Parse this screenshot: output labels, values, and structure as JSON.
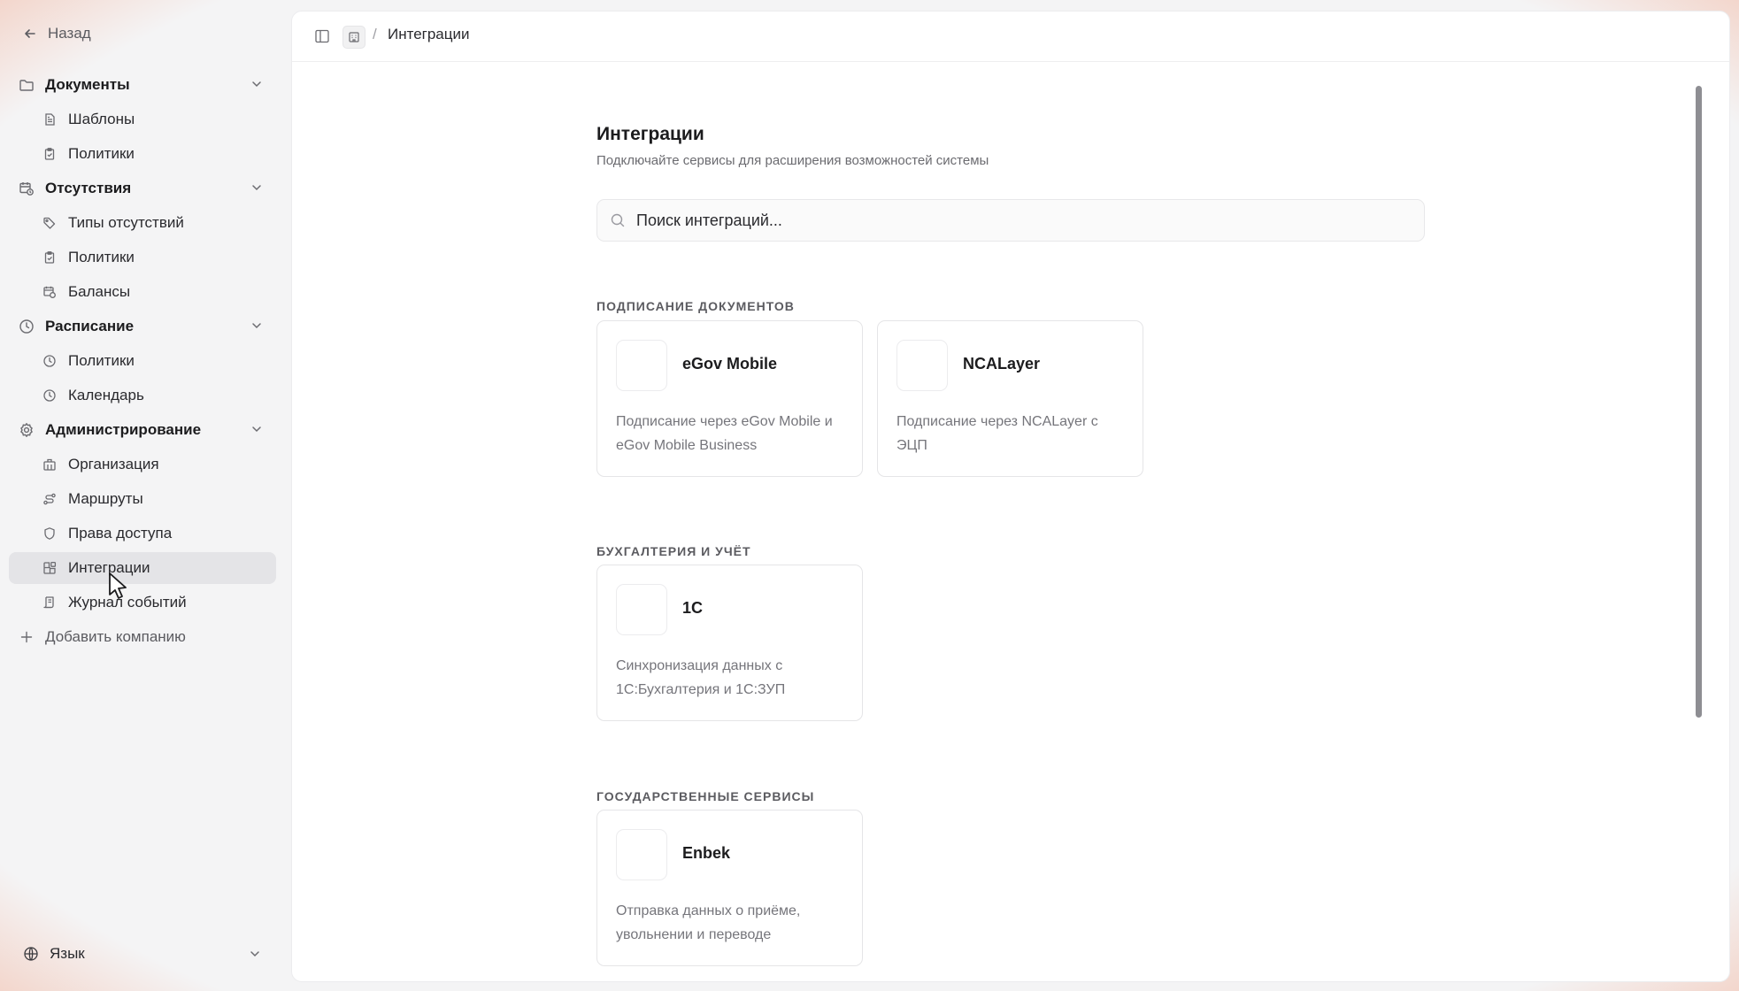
{
  "sidebar": {
    "back_label": "Назад",
    "sections": [
      {
        "label": "Документы",
        "icon": "folder-icon",
        "items": [
          {
            "label": "Шаблоны",
            "icon": "file-text-icon"
          },
          {
            "label": "Политики",
            "icon": "clipboard-check-icon"
          }
        ]
      },
      {
        "label": "Отсутствия",
        "icon": "calendar-clock-icon",
        "items": [
          {
            "label": "Типы отсутствий",
            "icon": "tags-icon"
          },
          {
            "label": "Политики",
            "icon": "clipboard-check-icon"
          },
          {
            "label": "Балансы",
            "icon": "calendar-clock-icon"
          }
        ]
      },
      {
        "label": "Расписание",
        "icon": "clock-icon",
        "items": [
          {
            "label": "Политики",
            "icon": "clock-icon"
          },
          {
            "label": "Календарь",
            "icon": "clock-icon"
          }
        ]
      },
      {
        "label": "Администрирование",
        "icon": "gear-icon",
        "items": [
          {
            "label": "Организация",
            "icon": "building-icon"
          },
          {
            "label": "Маршруты",
            "icon": "route-icon"
          },
          {
            "label": "Права доступа",
            "icon": "shield-icon"
          },
          {
            "label": "Интеграции",
            "icon": "blocks-icon",
            "active": true
          },
          {
            "label": "Журнал событий",
            "icon": "scroll-icon"
          }
        ]
      }
    ],
    "add_company_label": "Добавить компанию",
    "language_label": "Язык"
  },
  "topbar": {
    "breadcrumb_sep": "/",
    "breadcrumb_current": "Интеграции"
  },
  "page": {
    "title": "Интеграции",
    "subtitle": "Подключайте сервисы для расширения возможностей системы",
    "search_placeholder": "Поиск интеграций..."
  },
  "categories": [
    {
      "title": "ПОДПИСАНИЕ ДОКУМЕНТОВ",
      "cards": [
        {
          "name": "eGov Mobile",
          "desc": "Подписание через eGov Mobile и eGov Mobile Business"
        },
        {
          "name": "NCALayer",
          "desc": "Подписание через NCALayer с ЭЦП"
        }
      ]
    },
    {
      "title": "БУХГАЛТЕРИЯ И УЧЁТ",
      "cards": [
        {
          "name": "1С",
          "desc": "Синхронизация данных с 1С:Бухгалтерия и 1С:ЗУП"
        }
      ]
    },
    {
      "title": "ГОСУДАРСТВЕННЫЕ СЕРВИСЫ",
      "cards": [
        {
          "name": "Enbek",
          "desc": "Отправка данных о приёме, увольнении и переводе"
        }
      ]
    }
  ],
  "colors": {
    "background": "#f4f4f5",
    "panel": "#ffffff",
    "active_item": "#e4e4e7",
    "muted_text": "#6b6b70"
  }
}
